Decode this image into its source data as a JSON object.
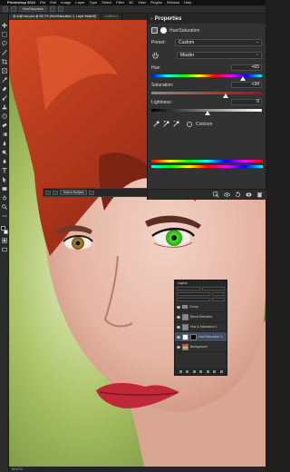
{
  "menubar": {
    "apple": "",
    "items": [
      "Photoshop 2024",
      "File",
      "Edit",
      "Image",
      "Layer",
      "Type",
      "Select",
      "Filter",
      "3D",
      "View",
      "Plugins",
      "Window",
      "Help"
    ],
    "clock": ""
  },
  "optionsbar": {
    "field": "Hue/Saturation"
  },
  "tabs": [
    {
      "label": "@ AdjEndo.psd @ 66.7% (Hue/Saturation 1, Layer Mask/8)",
      "active": true
    },
    {
      "label": "Untitled-1",
      "active": false
    }
  ],
  "floatbar": {
    "select_subject": "Select Subject"
  },
  "properties": {
    "title": "Properties",
    "adjustment_name": "Hue/Saturation",
    "preset_label": "Preset:",
    "preset_value": "Custom",
    "channel_value": "Master",
    "hue_label": "Hue:",
    "hue_value": "+65",
    "hue_level": 0.82,
    "saturation_label": "Saturation:",
    "saturation_value": "+34",
    "saturation_level": 0.67,
    "lightness_label": "Lightness:",
    "lightness_value": "0",
    "lightness_level": 0.5,
    "colorize_label": "Colorize"
  },
  "layers": {
    "title": "Layers",
    "rows": [
      {
        "name": "Group",
        "kind": "folder",
        "active": false
      },
      {
        "name": "Blend Selection",
        "kind": "adj",
        "active": false
      },
      {
        "name": "Hue & Saturation 1",
        "kind": "adj",
        "active": false
      },
      {
        "name": "Hue/Saturation 1",
        "kind": "mask",
        "active": true
      },
      {
        "name": "Background",
        "kind": "photo",
        "active": false
      }
    ]
  },
  "status": {
    "zoom": "66.67%"
  },
  "colors": {
    "accent_selected_layer": "#3f4f63",
    "hair": "#b43a1d",
    "background_green": "#6d8b2e",
    "eye_green": "#3ff01e",
    "lips": "#c0283a"
  }
}
